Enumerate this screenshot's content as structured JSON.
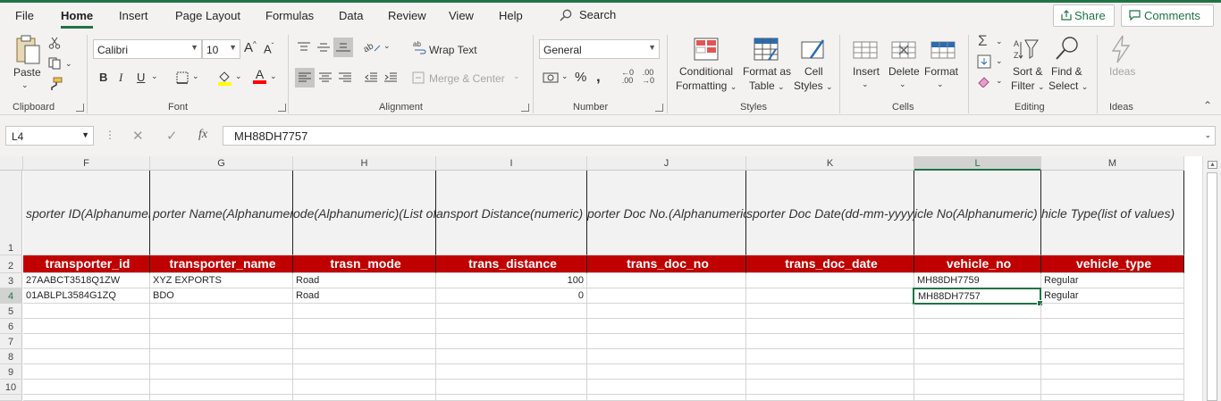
{
  "menu": {
    "tabs": [
      {
        "label": "File"
      },
      {
        "label": "Home"
      },
      {
        "label": "Insert"
      },
      {
        "label": "Page Layout"
      },
      {
        "label": "Formulas"
      },
      {
        "label": "Data"
      },
      {
        "label": "Review"
      },
      {
        "label": "View"
      },
      {
        "label": "Help"
      }
    ],
    "search_label": "Search",
    "share_label": "Share",
    "comments_label": "Comments"
  },
  "ribbon": {
    "clipboard": {
      "paste": "Paste",
      "group": "Clipboard"
    },
    "font": {
      "font_name": "Calibri",
      "font_size": "10",
      "group": "Font"
    },
    "alignment": {
      "wrap_text": "Wrap Text",
      "merge_center": "Merge & Center",
      "group": "Alignment"
    },
    "number": {
      "format": "General",
      "group": "Number"
    },
    "styles": {
      "conditional_1": "Conditional",
      "conditional_2": "Formatting",
      "format_table_1": "Format as",
      "format_table_2": "Table",
      "cell_styles_1": "Cell",
      "cell_styles_2": "Styles",
      "group": "Styles"
    },
    "cells": {
      "insert": "Insert",
      "delete": "Delete",
      "format": "Format",
      "group": "Cells"
    },
    "editing": {
      "sort_1": "Sort &",
      "sort_2": "Filter",
      "find_1": "Find &",
      "find_2": "Select",
      "group": "Editing"
    },
    "ideas": {
      "label": "Ideas",
      "group": "Ideas"
    }
  },
  "formula_bar": {
    "name_box": "L4",
    "fx": "fx",
    "formula": "MH88DH7757"
  },
  "sheet": {
    "columns": [
      "F",
      "G",
      "H",
      "I",
      "J",
      "K",
      "L",
      "M"
    ],
    "rows": [
      "1",
      "2",
      "3",
      "4",
      "5",
      "6",
      "7",
      "8",
      "9",
      "10"
    ],
    "row1": [
      "sporter ID(Alphanumeric)",
      "porter Name(Alphanumeric)",
      "ode(Alphanumeric)(List of values)",
      "ansport Distance(numeric)",
      "porter Doc No.(Alphanumeric)",
      "sporter Doc Date(dd-mm-yyyy)",
      "icle No(Alphanumeric)",
      "hicle Type(list of values)"
    ],
    "row2": [
      "transporter_id",
      "transporter_name",
      "trasn_mode",
      "trans_distance",
      "trans_doc_no",
      "trans_doc_date",
      "vehicle_no",
      "vehicle_type"
    ],
    "row3": [
      "27AABCT3518Q1ZW",
      "XYZ EXPORTS",
      "Road",
      "100",
      "",
      "",
      "MH88DH7759",
      "Regular"
    ],
    "row4": [
      "01ABLPL3584G1ZQ",
      "BDO",
      "Road",
      "0",
      "",
      "",
      "MH88DH7757",
      "Regular"
    ],
    "active_cell": "L4"
  }
}
